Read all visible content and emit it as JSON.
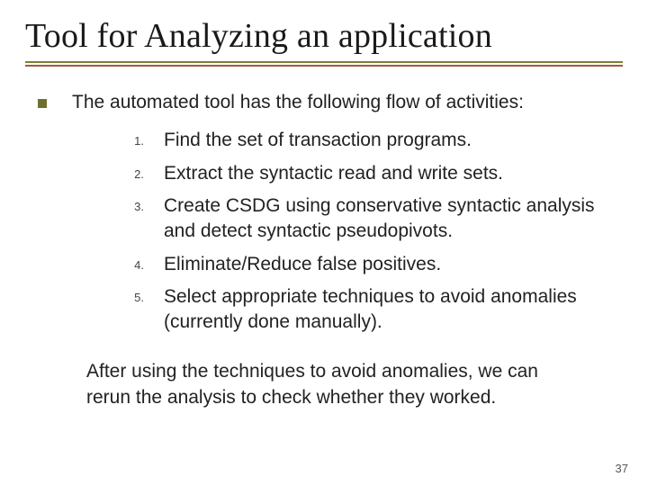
{
  "title": "Tool for Analyzing an application",
  "lead": "The automated tool has the following flow of activities:",
  "steps": [
    "Find the set of transaction programs.",
    "Extract the syntactic read and write sets.",
    "Create CSDG using conservative syntactic analysis and detect syntactic pseudopivots.",
    "Eliminate/Reduce false positives.",
    "Select appropriate techniques to avoid anomalies (currently done manually)."
  ],
  "closing": "After using the techniques to avoid anomalies, we can rerun the analysis to check whether they worked.",
  "page_number": "37"
}
